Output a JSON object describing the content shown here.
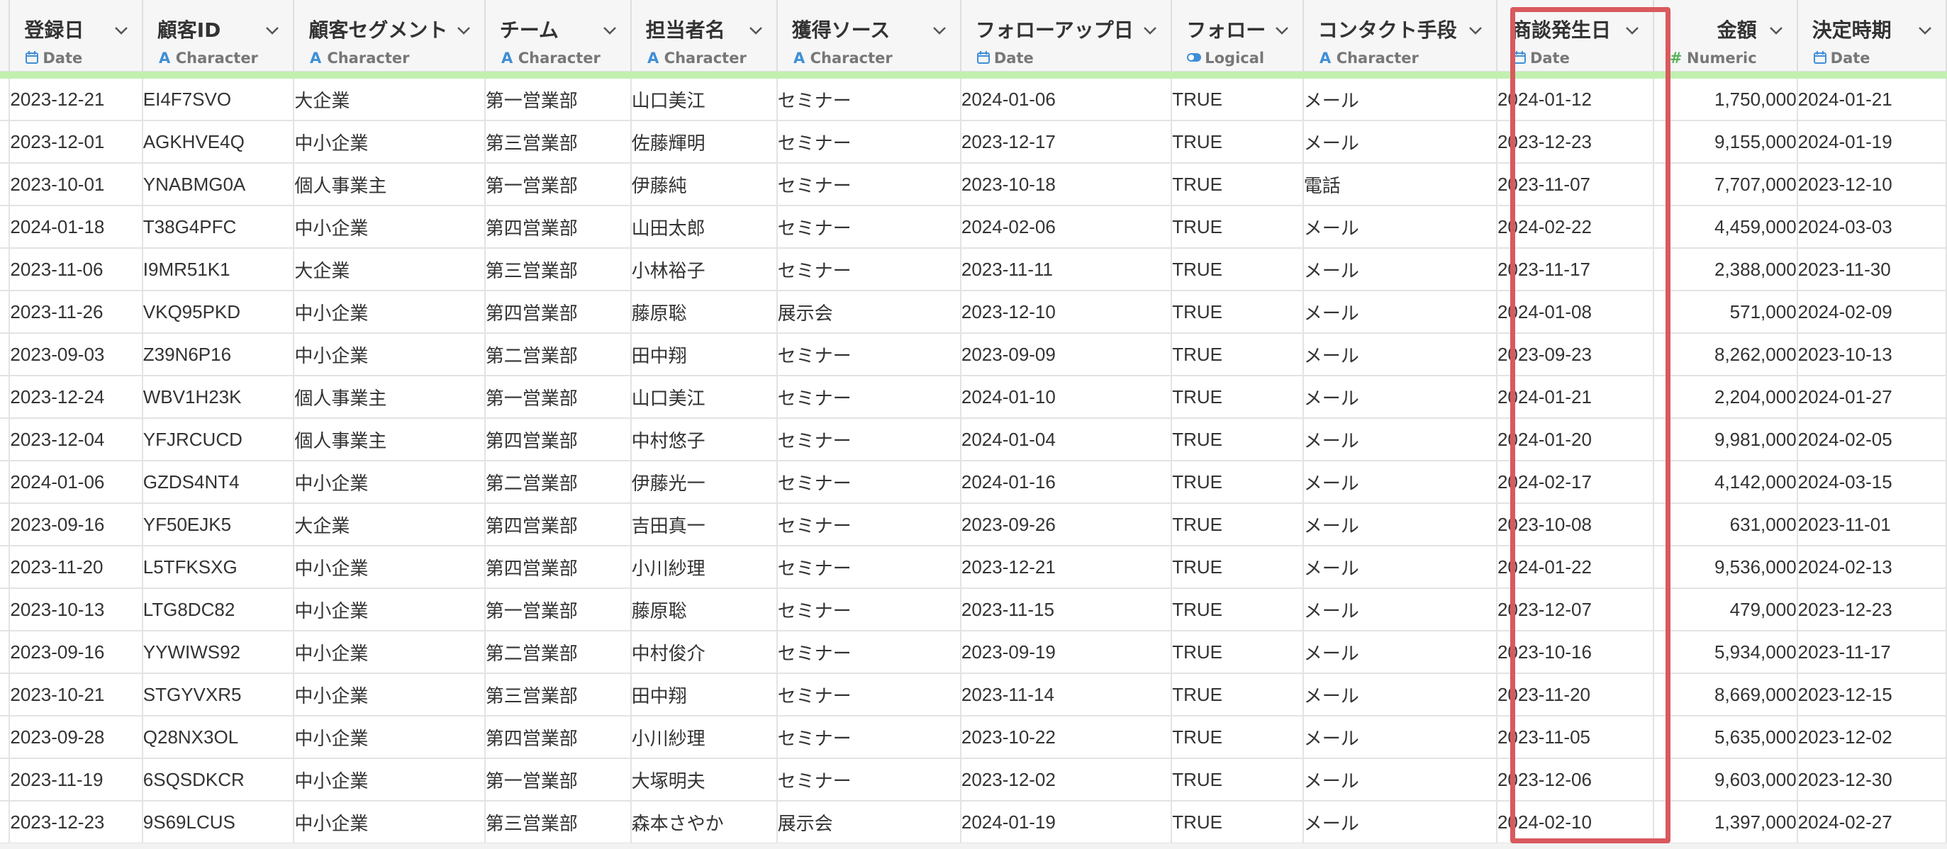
{
  "columns": [
    {
      "name": "登録日",
      "type": "Date",
      "icon": "date-icon"
    },
    {
      "name": "顧客ID",
      "type": "Character",
      "icon": "character-icon"
    },
    {
      "name": "顧客セグメント",
      "type": "Character",
      "icon": "character-icon"
    },
    {
      "name": "チーム",
      "type": "Character",
      "icon": "character-icon"
    },
    {
      "name": "担当者名",
      "type": "Character",
      "icon": "character-icon"
    },
    {
      "name": "獲得ソース",
      "type": "Character",
      "icon": "character-icon"
    },
    {
      "name": "フォローアップ日",
      "type": "Date",
      "icon": "date-icon"
    },
    {
      "name": "フォロー",
      "type": "Logical",
      "icon": "logical-icon"
    },
    {
      "name": "コンタクト手段",
      "type": "Character",
      "icon": "character-icon"
    },
    {
      "name": "商談発生日",
      "type": "Date",
      "icon": "date-icon"
    },
    {
      "name": "金額",
      "type": "Numeric",
      "icon": "numeric-icon"
    },
    {
      "name": "決定時期",
      "type": "Date",
      "icon": "date-icon"
    }
  ],
  "highlighted_column": "商談発生日",
  "colors": {
    "highlight": "#d9595e",
    "header_bg": "#f6f6f7",
    "quality_bar": "#c2f0b0",
    "type_icon": "#3f8fd6",
    "numeric_icon": "#56b35c"
  },
  "rows": [
    [
      "2023-12-21",
      "EI4F7SVO",
      "大企業",
      "第一営業部",
      "山口美江",
      "セミナー",
      "2024-01-06",
      "TRUE",
      "メール",
      "2024-01-12",
      "1,750,000",
      "2024-01-21"
    ],
    [
      "2023-12-01",
      "AGKHVE4Q",
      "中小企業",
      "第三営業部",
      "佐藤輝明",
      "セミナー",
      "2023-12-17",
      "TRUE",
      "メール",
      "2023-12-23",
      "9,155,000",
      "2024-01-19"
    ],
    [
      "2023-10-01",
      "YNABMG0A",
      "個人事業主",
      "第一営業部",
      "伊藤純",
      "セミナー",
      "2023-10-18",
      "TRUE",
      "電話",
      "2023-11-07",
      "7,707,000",
      "2023-12-10"
    ],
    [
      "2024-01-18",
      "T38G4PFC",
      "中小企業",
      "第四営業部",
      "山田太郎",
      "セミナー",
      "2024-02-06",
      "TRUE",
      "メール",
      "2024-02-22",
      "4,459,000",
      "2024-03-03"
    ],
    [
      "2023-11-06",
      "I9MR51K1",
      "大企業",
      "第三営業部",
      "小林裕子",
      "セミナー",
      "2023-11-11",
      "TRUE",
      "メール",
      "2023-11-17",
      "2,388,000",
      "2023-11-30"
    ],
    [
      "2023-11-26",
      "VKQ95PKD",
      "中小企業",
      "第四営業部",
      "藤原聡",
      "展示会",
      "2023-12-10",
      "TRUE",
      "メール",
      "2024-01-08",
      "571,000",
      "2024-02-09"
    ],
    [
      "2023-09-03",
      "Z39N6P16",
      "中小企業",
      "第二営業部",
      "田中翔",
      "セミナー",
      "2023-09-09",
      "TRUE",
      "メール",
      "2023-09-23",
      "8,262,000",
      "2023-10-13"
    ],
    [
      "2023-12-24",
      "WBV1H23K",
      "個人事業主",
      "第一営業部",
      "山口美江",
      "セミナー",
      "2024-01-10",
      "TRUE",
      "メール",
      "2024-01-21",
      "2,204,000",
      "2024-01-27"
    ],
    [
      "2023-12-04",
      "YFJRCUCD",
      "個人事業主",
      "第四営業部",
      "中村悠子",
      "セミナー",
      "2024-01-04",
      "TRUE",
      "メール",
      "2024-01-20",
      "9,981,000",
      "2024-02-05"
    ],
    [
      "2024-01-06",
      "GZDS4NT4",
      "中小企業",
      "第二営業部",
      "伊藤光一",
      "セミナー",
      "2024-01-16",
      "TRUE",
      "メール",
      "2024-02-17",
      "4,142,000",
      "2024-03-15"
    ],
    [
      "2023-09-16",
      "YF50EJK5",
      "大企業",
      "第四営業部",
      "吉田真一",
      "セミナー",
      "2023-09-26",
      "TRUE",
      "メール",
      "2023-10-08",
      "631,000",
      "2023-11-01"
    ],
    [
      "2023-11-20",
      "L5TFKSXG",
      "中小企業",
      "第四営業部",
      "小川紗理",
      "セミナー",
      "2023-12-21",
      "TRUE",
      "メール",
      "2024-01-22",
      "9,536,000",
      "2024-02-13"
    ],
    [
      "2023-10-13",
      "LTG8DC82",
      "中小企業",
      "第一営業部",
      "藤原聡",
      "セミナー",
      "2023-11-15",
      "TRUE",
      "メール",
      "2023-12-07",
      "479,000",
      "2023-12-23"
    ],
    [
      "2023-09-16",
      "YYWIWS92",
      "中小企業",
      "第二営業部",
      "中村俊介",
      "セミナー",
      "2023-09-19",
      "TRUE",
      "メール",
      "2023-10-16",
      "5,934,000",
      "2023-11-17"
    ],
    [
      "2023-10-21",
      "STGYVXR5",
      "中小企業",
      "第三営業部",
      "田中翔",
      "セミナー",
      "2023-11-14",
      "TRUE",
      "メール",
      "2023-11-20",
      "8,669,000",
      "2023-12-15"
    ],
    [
      "2023-09-28",
      "Q28NX3OL",
      "中小企業",
      "第四営業部",
      "小川紗理",
      "セミナー",
      "2023-10-22",
      "TRUE",
      "メール",
      "2023-11-05",
      "5,635,000",
      "2023-12-02"
    ],
    [
      "2023-11-19",
      "6SQSDKCR",
      "中小企業",
      "第一営業部",
      "大塚明夫",
      "セミナー",
      "2023-12-02",
      "TRUE",
      "メール",
      "2023-12-06",
      "9,603,000",
      "2023-12-30"
    ],
    [
      "2023-12-23",
      "9S69LCUS",
      "中小企業",
      "第三営業部",
      "森本さやか",
      "展示会",
      "2024-01-19",
      "TRUE",
      "メール",
      "2024-02-10",
      "1,397,000",
      "2024-02-27"
    ]
  ]
}
